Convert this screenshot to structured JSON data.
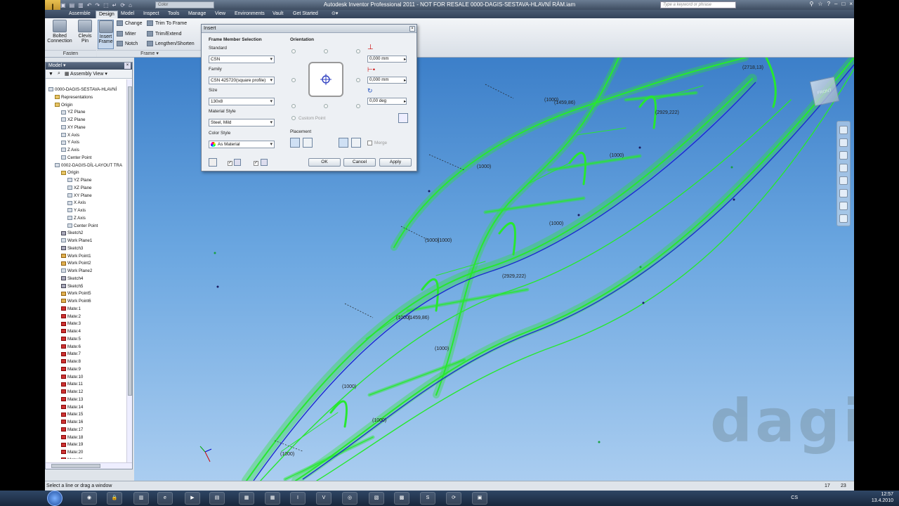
{
  "window": {
    "title": "Autodesk Inventor Professional 2011 - NOT FOR RESALE   0000-DAGIS-SESTAVA-HLAVNÍ RÁM.iam",
    "color_select": "Color",
    "search_placeholder": "Type a keyword or phrase"
  },
  "tabs": [
    "Assemble",
    "Design",
    "Model",
    "Inspect",
    "Tools",
    "Manage",
    "View",
    "Environments",
    "Vault",
    "Get Started"
  ],
  "ribbon": {
    "fasten": {
      "bolted_line1": "Bolted",
      "bolted_line2": "Connection",
      "clevis_line1": "Clevis",
      "clevis_line2": "Pin",
      "group_label": "Fasten"
    },
    "frame": {
      "insert_line1": "Insert",
      "insert_line2": "Frame",
      "change": "Change",
      "miter": "Miter",
      "notch": "Notch",
      "trim_to_frame": "Trim To Frame",
      "trim_extend": "Trim/Extend",
      "lengthen_shorten": "Lengthen/Shorten",
      "group_label": "Frame"
    }
  },
  "browser": {
    "header": "Model",
    "view_label": "Assembly View",
    "tree": [
      "0000-DAGIS-SESTAVA-HLAVNÍ",
      "Representations",
      "Origin",
      "YZ Plane",
      "XZ Plane",
      "XY Plane",
      "X Axis",
      "Y Axis",
      "Z Axis",
      "Center Point",
      "0002-DAGIS-DÍL-LAYOUT TRA",
      "Origin",
      "YZ Plane",
      "XZ Plane",
      "XY Plane",
      "X Axis",
      "Y Axis",
      "Z Axis",
      "Center Point",
      "Sketch2",
      "Work Plane1",
      "Sketch3",
      "Work Point1",
      "Work Point2",
      "Work Plane2",
      "Sketch4",
      "Sketch5",
      "Work Point5",
      "Work Point6",
      "Mate:1",
      "Mate:2",
      "Mate:3",
      "Mate:4",
      "Mate:5",
      "Mate:6",
      "Mate:7",
      "Mate:8",
      "Mate:9",
      "Mate:10",
      "Mate:11",
      "Mate:12",
      "Mate:13",
      "Mate:14",
      "Mate:15",
      "Mate:16",
      "Mate:17",
      "Mate:18",
      "Mate:19",
      "Mate:20",
      "Mate:21"
    ]
  },
  "dialog": {
    "title": "Insert",
    "frame_member_selection": "Frame Member Selection",
    "standard_label": "Standard",
    "standard_value": "CSN",
    "family_label": "Family",
    "family_value": "CSN 425720(square profile)",
    "size_label": "Size",
    "size_value": "130x8",
    "material_label": "Material Style",
    "material_value": "Steel, Mild",
    "color_label": "Color Style",
    "color_value": "As Material",
    "orientation_label": "Orientation",
    "offset1": "0,000 mm",
    "offset2": "0,000 mm",
    "rotation": "0,00 deg",
    "custom_point": "Custom Point",
    "placement_label": "Placement",
    "merge": "Merge",
    "ok": "OK",
    "cancel": "Cancel",
    "apply": "Apply"
  },
  "viewport": {
    "labels": [
      "(2718,13)",
      "(1000)",
      "(1459,86)",
      "(2929,222)",
      "(1000)",
      "(1000)",
      "(1000)",
      "(1000)",
      "(1000)",
      "(2929,222)",
      "(1000)",
      "(1000)",
      "(1459,86)",
      "(1000)",
      "(1000)",
      "(1000)"
    ],
    "watermark": "dagis",
    "viewcube": "FRONT"
  },
  "status": {
    "message": "Select a line or drag a window",
    "count1": "17",
    "count2": "23"
  },
  "taskbar": {
    "lang": "CS",
    "time": "12:57",
    "date": "13.4.2010"
  }
}
